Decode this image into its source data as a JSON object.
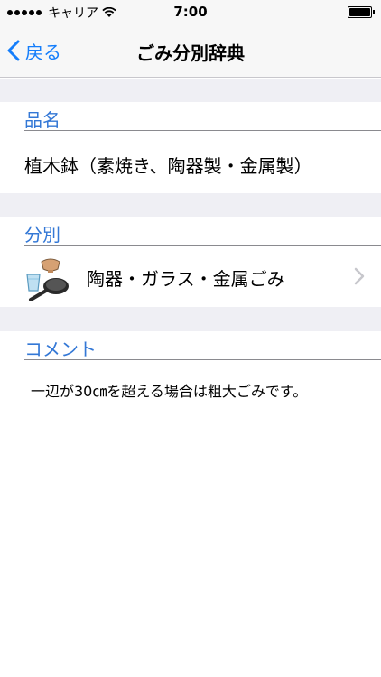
{
  "status_bar": {
    "carrier": "キャリア",
    "time": "7:00"
  },
  "nav": {
    "back_label": "戻る",
    "title": "ごみ分別辞典"
  },
  "item": {
    "header": "品名",
    "name": "植木鉢（素焼き、陶器製・金属製）"
  },
  "category": {
    "header": "分別",
    "label": "陶器・ガラス・金属ごみ",
    "icon": "pottery-glass-metal-icon"
  },
  "comment": {
    "header": "コメント",
    "text": "一辺が30㎝を超える場合は粗大ごみです。"
  },
  "colors": {
    "accent": "#157efb",
    "section_header": "#3478d6",
    "group_background": "#efeff4"
  }
}
